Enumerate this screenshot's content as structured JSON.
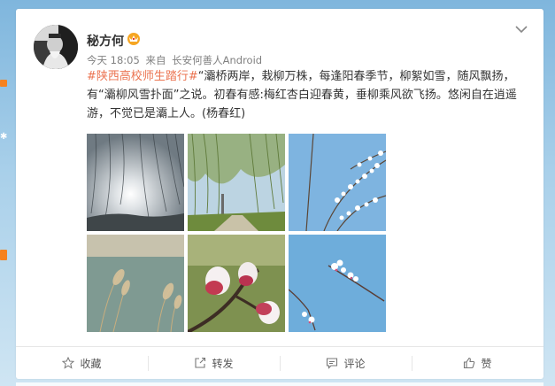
{
  "post": {
    "username": "秘方何",
    "time": "今天 18:05",
    "source_prefix": "来自",
    "source": "长安何善人Android",
    "topic": "#陕西高校师生踏行#",
    "text": "“灞桥两岸，栽柳万株，每逢阳春季节，柳絮如雪，随风飘扬，有“灞柳风雪扑面”之说。初春有感:梅红杏白迎春黄，垂柳乘风欲飞扬。悠闲自在逍遥游，不觉已是灞上人。(杨春红)"
  },
  "images": [
    {
      "name": "willow-sun"
    },
    {
      "name": "willow-path"
    },
    {
      "name": "white-blossoms"
    },
    {
      "name": "reeds-river"
    },
    {
      "name": "peach-buds"
    },
    {
      "name": "blossom-branch"
    }
  ],
  "toolbar": {
    "favorite_label": "收藏",
    "repost_label": "转发",
    "comment_label": "评论",
    "like_label": "赞"
  },
  "colors": {
    "topic": "#eb7350",
    "page_bg": "#a9d0ea"
  }
}
